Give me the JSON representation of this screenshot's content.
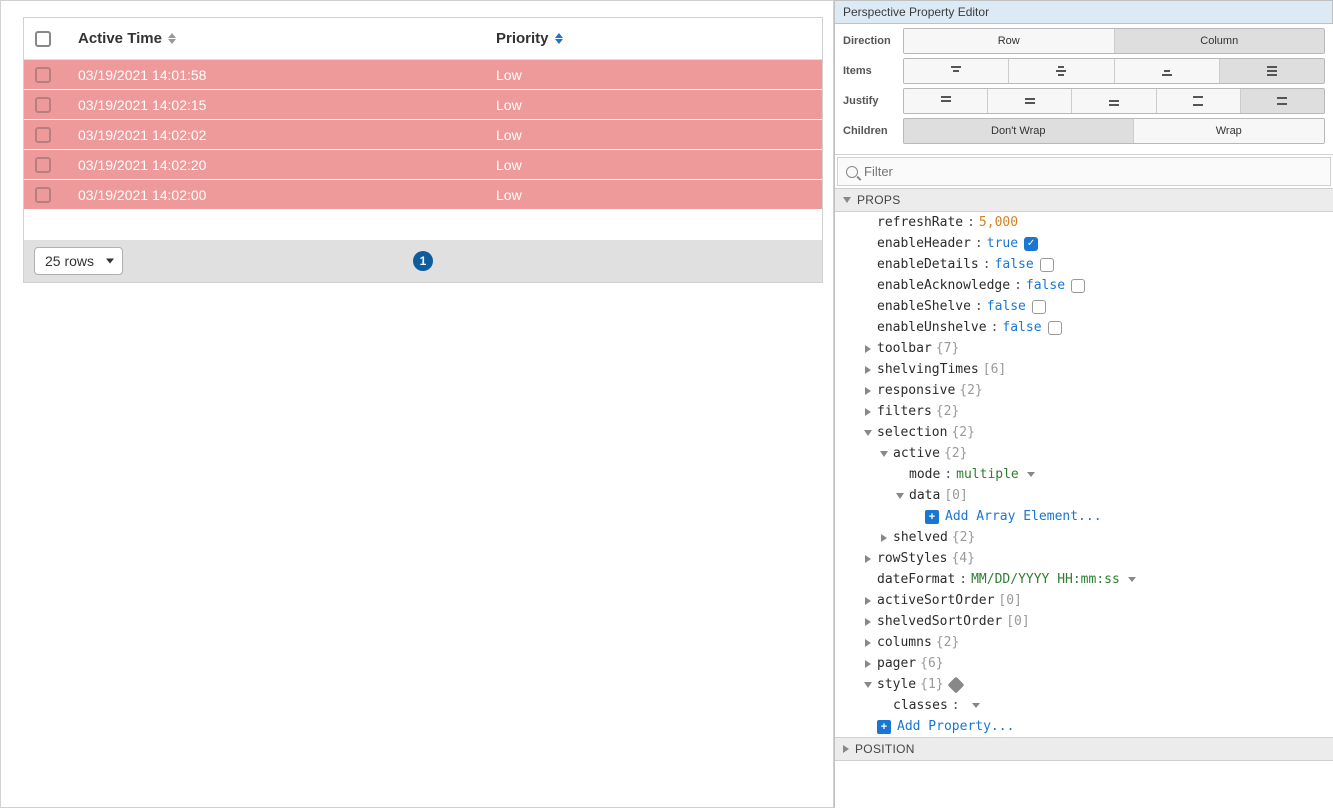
{
  "table": {
    "headers": {
      "activeTime": "Active Time",
      "priority": "Priority"
    },
    "rows": [
      {
        "activeTime": "03/19/2021 14:01:58",
        "priority": "Low"
      },
      {
        "activeTime": "03/19/2021 14:02:15",
        "priority": "Low"
      },
      {
        "activeTime": "03/19/2021 14:02:02",
        "priority": "Low"
      },
      {
        "activeTime": "03/19/2021 14:02:20",
        "priority": "Low"
      },
      {
        "activeTime": "03/19/2021 14:02:00",
        "priority": "Low"
      }
    ],
    "rowsSelectLabel": "25 rows",
    "pageNumber": "1"
  },
  "editor": {
    "title": "Perspective Property Editor",
    "toolbar": {
      "direction": {
        "label": "Direction",
        "row": "Row",
        "column": "Column"
      },
      "items": {
        "label": "Items"
      },
      "justify": {
        "label": "Justify"
      },
      "children": {
        "label": "Children",
        "dontwrap": "Don't Wrap",
        "wrap": "Wrap"
      }
    },
    "filterPlaceholder": "Filter",
    "sections": {
      "props": "PROPS",
      "position": "POSITION"
    },
    "props": {
      "refreshRate": {
        "key": "refreshRate",
        "value": "5,000"
      },
      "enableHeader": {
        "key": "enableHeader",
        "value": "true"
      },
      "enableDetails": {
        "key": "enableDetails",
        "value": "false"
      },
      "enableAcknowledge": {
        "key": "enableAcknowledge",
        "value": "false"
      },
      "enableShelve": {
        "key": "enableShelve",
        "value": "false"
      },
      "enableUnshelve": {
        "key": "enableUnshelve",
        "value": "false"
      },
      "toolbar": {
        "key": "toolbar",
        "count": "{7}"
      },
      "shelvingTimes": {
        "key": "shelvingTimes",
        "count": "[6]"
      },
      "responsive": {
        "key": "responsive",
        "count": "{2}"
      },
      "filters": {
        "key": "filters",
        "count": "{2}"
      },
      "selection": {
        "key": "selection",
        "count": "{2}"
      },
      "active": {
        "key": "active",
        "count": "{2}"
      },
      "mode": {
        "key": "mode",
        "value": "multiple"
      },
      "data": {
        "key": "data",
        "count": "[0]"
      },
      "addArrayElement": "Add Array Element...",
      "shelved": {
        "key": "shelved",
        "count": "{2}"
      },
      "rowStyles": {
        "key": "rowStyles",
        "count": "{4}"
      },
      "dateFormat": {
        "key": "dateFormat",
        "value": "MM/DD/YYYY HH:mm:ss"
      },
      "activeSortOrder": {
        "key": "activeSortOrder",
        "count": "[0]"
      },
      "shelvedSortOrder": {
        "key": "shelvedSortOrder",
        "count": "[0]"
      },
      "columns": {
        "key": "columns",
        "count": "{2}"
      },
      "pager": {
        "key": "pager",
        "count": "{6}"
      },
      "style": {
        "key": "style",
        "count": "{1}"
      },
      "classes": {
        "key": "classes"
      },
      "addProperty": "Add Property..."
    }
  }
}
